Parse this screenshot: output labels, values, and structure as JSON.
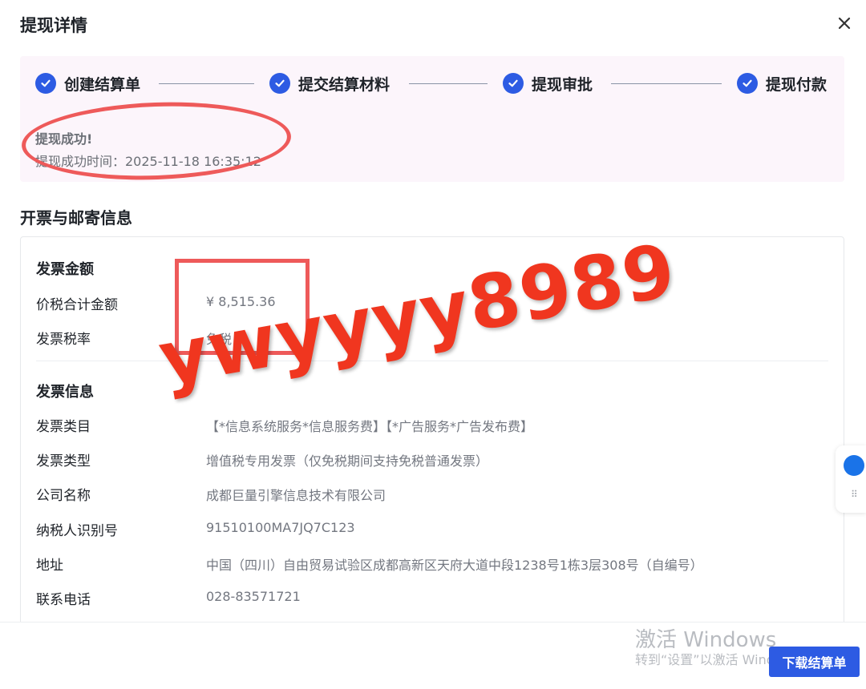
{
  "dialog": {
    "title": "提现详情"
  },
  "steps": [
    {
      "label": "创建结算单"
    },
    {
      "label": "提交结算材料"
    },
    {
      "label": "提现审批"
    },
    {
      "label": "提现付款"
    }
  ],
  "status": {
    "title": "提现成功!",
    "time": "提现成功时间：2025-11-18 16:35:12"
  },
  "section": {
    "title": "开票与邮寄信息"
  },
  "invoice_amount": {
    "title": "发票金额",
    "rows": [
      {
        "label": "价税合计金额",
        "value": "¥ 8,515.36"
      },
      {
        "label": "发票税率",
        "value": "免税"
      }
    ]
  },
  "invoice_info": {
    "title": "发票信息",
    "rows": [
      {
        "label": "发票类目",
        "value": "【*信息系统服务*信息服务费】【*广告服务*广告发布费】"
      },
      {
        "label": "发票类型",
        "value": "增值税专用发票（仅免税期间支持免税普通发票）"
      },
      {
        "label": "公司名称",
        "value": "成都巨量引擎信息技术有限公司"
      },
      {
        "label": "纳税人识别号",
        "value": "91510100MA7JQ7C123"
      },
      {
        "label": "地址",
        "value": "中国（四川）自由贸易试验区成都高新区天府大道中段1238号1栋3层308号（自编号）"
      },
      {
        "label": "联系电话",
        "value": "028-83571721"
      }
    ]
  },
  "watermark": {
    "text": "ywyyyy8989"
  },
  "os_overlay": {
    "title": "激活 Windows",
    "subtitle": "转到“设置”以激活 Windows。"
  },
  "footer": {
    "download_label": "下载结算单"
  },
  "colors": {
    "accent": "#2d5be3",
    "annotation_red": "#ee5a5a",
    "panel_bg": "#fcf5fb"
  }
}
